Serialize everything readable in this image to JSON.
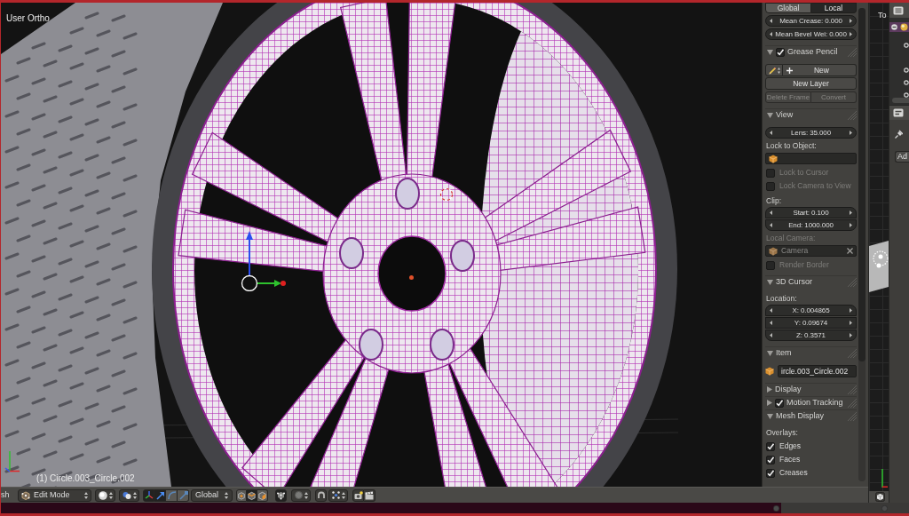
{
  "viewport": {
    "view_name": "User Ortho",
    "active_object": "(1) Circle.003_Circle.002"
  },
  "properties_panel": {
    "orientation_tabs": [
      {
        "label": "Global",
        "selected": false
      },
      {
        "label": "Local",
        "selected": true
      }
    ],
    "number_fields": [
      "Mean Crease: 0.000",
      "Mean Bevel Wei: 0.000"
    ],
    "panels": [
      {
        "title": "Grease Pencil",
        "kind": "toggle",
        "checked": true,
        "expanded": true,
        "rows": [
          {
            "kind": "add_row",
            "label": "New"
          },
          {
            "kind": "button",
            "label": "New Layer"
          },
          {
            "kind": "button_pair",
            "labels": [
              "Delete Frame",
              "Convert"
            ],
            "disabled": true
          }
        ]
      },
      {
        "title": "View",
        "kind": "plain",
        "expanded": true,
        "rows": [
          {
            "kind": "number",
            "label": "Lens: 35.000"
          },
          {
            "kind": "label",
            "label": "Lock to Object:",
            "disabled": false
          },
          {
            "kind": "object_field",
            "disabled": false
          },
          {
            "kind": "checkbox",
            "label": "Lock to Cursor",
            "checked": false,
            "disabled": true
          },
          {
            "kind": "checkbox",
            "label": "Lock Camera to View",
            "checked": false,
            "disabled": true
          },
          {
            "kind": "label",
            "label": "Clip:",
            "disabled": false
          },
          {
            "kind": "number",
            "label": "Start: 0.100"
          },
          {
            "kind": "number",
            "label": "End: 1000.000"
          },
          {
            "kind": "label",
            "label": "Local Camera:",
            "disabled": true
          },
          {
            "kind": "object_field",
            "value": "Camera",
            "disabled": true
          },
          {
            "kind": "checkbox",
            "label": "Render Border",
            "checked": false,
            "disabled": true
          }
        ]
      },
      {
        "title": "3D Cursor",
        "kind": "plain",
        "expanded": true,
        "rows": [
          {
            "kind": "label",
            "label": "Location:",
            "disabled": false
          },
          {
            "kind": "number",
            "label": "X: 0.004865"
          },
          {
            "kind": "number",
            "label": "Y: 0.09674"
          },
          {
            "kind": "number",
            "label": "Z: 0.3571"
          }
        ]
      },
      {
        "title": "Item",
        "kind": "plain",
        "expanded": true,
        "rows": [
          {
            "kind": "name_field",
            "value": "ircle.003_Circle.002"
          }
        ]
      },
      {
        "title": "Display",
        "kind": "plain",
        "expanded": false
      },
      {
        "title": "Motion Tracking",
        "kind": "toggle",
        "checked": true,
        "expanded": false
      },
      {
        "title": "Mesh Display",
        "kind": "plain",
        "expanded": true,
        "rows": [
          {
            "kind": "label",
            "label": "Overlays:",
            "disabled": false
          },
          {
            "kind": "checkbox",
            "label": "Edges",
            "checked": true,
            "disabled": false
          },
          {
            "kind": "checkbox",
            "label": "Faces",
            "checked": true,
            "disabled": false
          },
          {
            "kind": "checkbox",
            "label": "Creases",
            "checked": true,
            "disabled": false
          }
        ]
      }
    ]
  },
  "header_bar": {
    "editor_menu": "sh",
    "mode": "Edit Mode",
    "manipulators": [
      {
        "kind": "axes",
        "selected": true
      },
      {
        "kind": "translate",
        "selected": true
      },
      {
        "kind": "rotate",
        "selected": false
      },
      {
        "kind": "scale",
        "selected": false
      }
    ],
    "orientation": "Global",
    "select_modes": [
      {
        "kind": "vertex",
        "selected": false
      },
      {
        "kind": "edge",
        "selected": true
      },
      {
        "kind": "face",
        "selected": false
      }
    ],
    "occlude_geometry": {
      "on": true
    }
  },
  "side_viewport": {
    "label": "To"
  },
  "side_properties": {
    "button": "Ad"
  }
}
